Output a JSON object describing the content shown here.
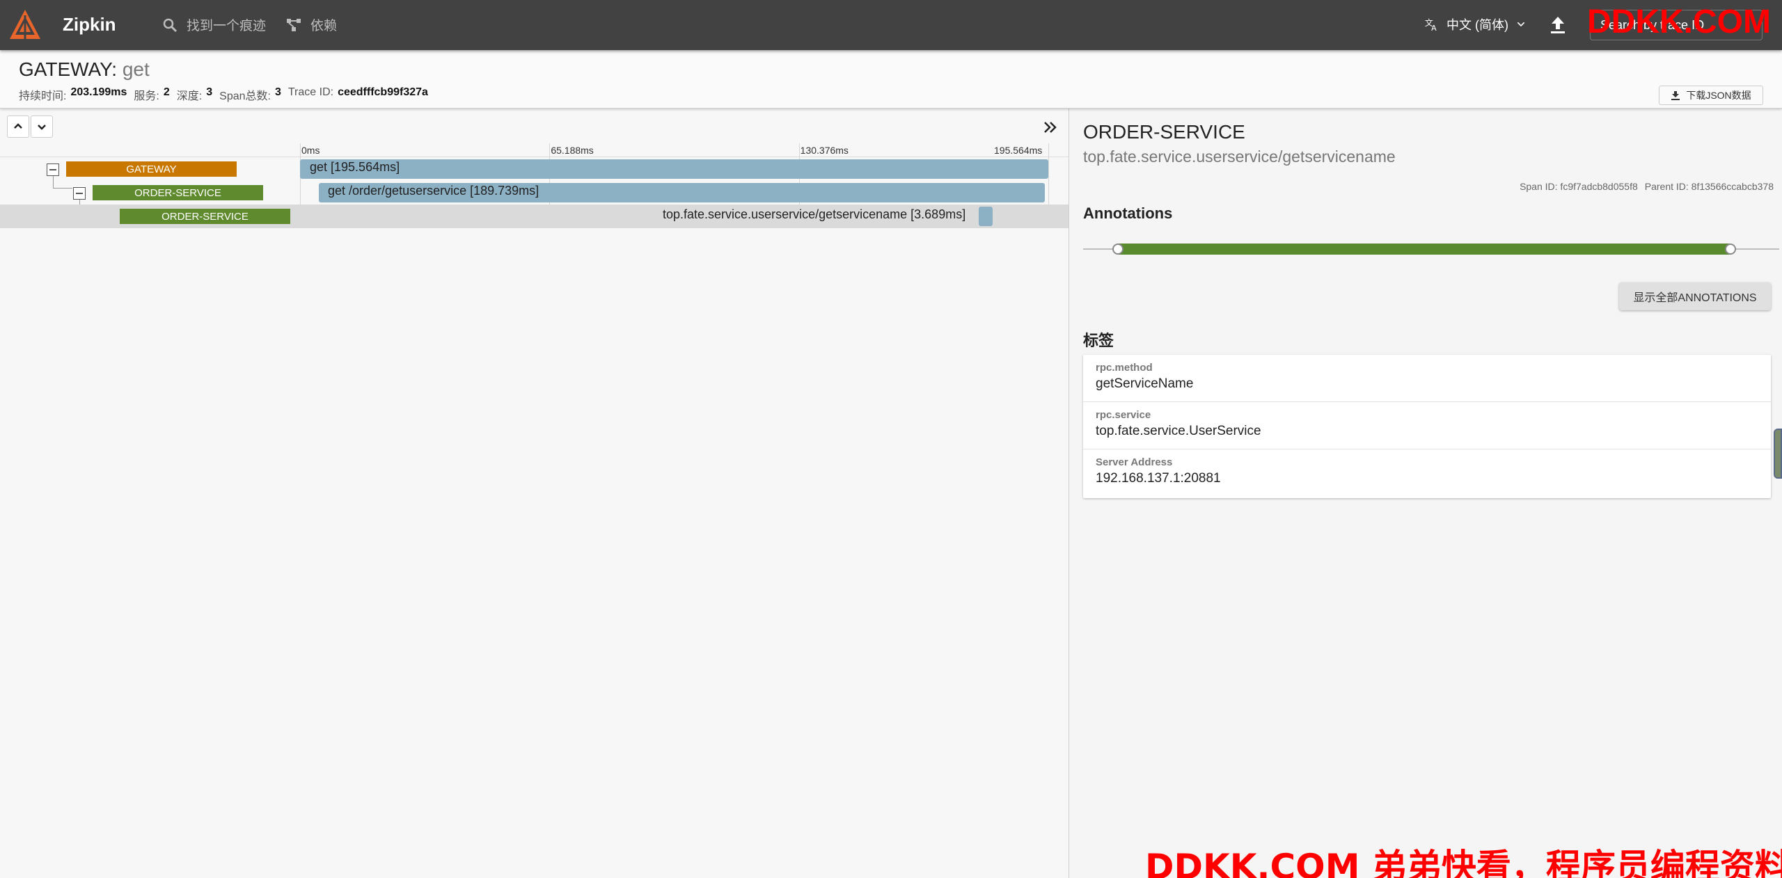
{
  "app": {
    "brand": "Zipkin",
    "nav": {
      "find_trace": "找到一个痕迹",
      "dependencies": "依赖"
    },
    "language": "中文 (简体)",
    "search_placeholder": "Search by trace ID"
  },
  "watermark": {
    "top": "DDKK.COM",
    "bottom": "DDKK.COM 弟弟快看，程序员编程资料站"
  },
  "trace": {
    "service": "GATEWAY",
    "sep": ":",
    "operation": "get",
    "summary": {
      "duration_label": "持续时间:",
      "duration": "203.199ms",
      "services_label": "服务:",
      "services": "2",
      "depth_label": "深度:",
      "depth": "3",
      "span_total_label": "Span总数:",
      "span_total": "3",
      "trace_id_label": "Trace ID:",
      "trace_id": "ceedfffcb99f327a"
    },
    "download_label": "下载JSON数据"
  },
  "timeline": {
    "ticks": [
      "0ms",
      "65.188ms",
      "130.376ms",
      "195.564ms"
    ],
    "spans": [
      {
        "service": "GATEWAY",
        "label": "get [195.564ms]",
        "color": "#c87800",
        "start": 0.0,
        "duration": 1.0,
        "depth": 0
      },
      {
        "service": "ORDER-SERVICE",
        "label": "get /order/getuserservice [189.739ms]",
        "color": "#5f8a2e",
        "start": 0.025,
        "duration": 0.97,
        "depth": 1
      },
      {
        "service": "ORDER-SERVICE",
        "label": "top.fate.service.userservice/getservicename [3.689ms]",
        "color": "#5f8a2e",
        "start": 0.907,
        "duration": 0.019,
        "depth": 2
      }
    ]
  },
  "detail": {
    "service": "ORDER-SERVICE",
    "operation": "top.fate.service.userservice/getservicename",
    "span_id": "Span ID: fc9f7adcb8d055f8",
    "parent_id": "Parent ID: 8f13566ccabcb378",
    "annotations_title": "Annotations",
    "show_all_label": "显示全部ANNOTATIONS",
    "tags_title": "标签",
    "tags": [
      {
        "key": "rpc.method",
        "value": "getServiceName"
      },
      {
        "key": "rpc.service",
        "value": "top.fate.service.UserService"
      },
      {
        "key": "Server Address",
        "value": "192.168.137.1:20881"
      }
    ]
  }
}
